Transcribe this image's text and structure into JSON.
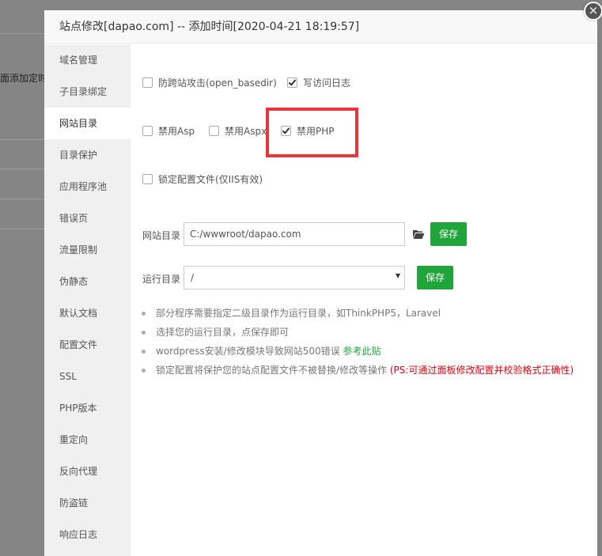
{
  "background": {
    "partial_text": "面添加定时任"
  },
  "modal": {
    "title": "站点修改[dapao.com] -- 添加时间[2020-04-21 18:19:57]",
    "close_glyph": "×"
  },
  "sidebar": {
    "items": [
      {
        "label": "域名管理"
      },
      {
        "label": "子目录绑定"
      },
      {
        "label": "网站目录",
        "active": true
      },
      {
        "label": "目录保护"
      },
      {
        "label": "应用程序池"
      },
      {
        "label": "错误页"
      },
      {
        "label": "流量限制"
      },
      {
        "label": "伪静态"
      },
      {
        "label": "默认文档"
      },
      {
        "label": "配置文件"
      },
      {
        "label": "SSL"
      },
      {
        "label": "PHP版本"
      },
      {
        "label": "重定向"
      },
      {
        "label": "反向代理"
      },
      {
        "label": "防盗链"
      },
      {
        "label": "响应日志"
      }
    ]
  },
  "options": {
    "open_basedir": {
      "label": "防跨站攻击(open_basedir)",
      "checked": false
    },
    "access_log": {
      "label": "写访问日志",
      "checked": true
    },
    "disable_asp": {
      "label": "禁用Asp",
      "checked": false
    },
    "disable_aspx": {
      "label": "禁用Aspx",
      "checked": false
    },
    "disable_php": {
      "label": "禁用PHP",
      "checked": true
    },
    "lock_config": {
      "label": "锁定配置文件(仅IIS有效)",
      "checked": false
    }
  },
  "site_dir": {
    "label": "网站目录",
    "value": "C:/wwwroot/dapao.com",
    "icon": "folder-open-icon",
    "save_label": "保存"
  },
  "run_dir": {
    "label": "运行目录",
    "value": "/",
    "save_label": "保存"
  },
  "tips": {
    "t1": "部分程序需要指定二级目录作为运行目录，如ThinkPHP5，Laravel",
    "t2": "选择您的运行目录，点保存即可",
    "t3": "wordpress安装/修改模块导致网站500错误 ",
    "t3_link": "参考此贴",
    "t4": "锁定配置将保护您的站点配置文件不被替换/修改等操作 ",
    "t4_warn": "(PS:可通过面板修改配置并校验格式正确性)"
  },
  "colors": {
    "accent": "#20a53a",
    "highlight": "#e8343a",
    "warning": "#e5000c"
  }
}
